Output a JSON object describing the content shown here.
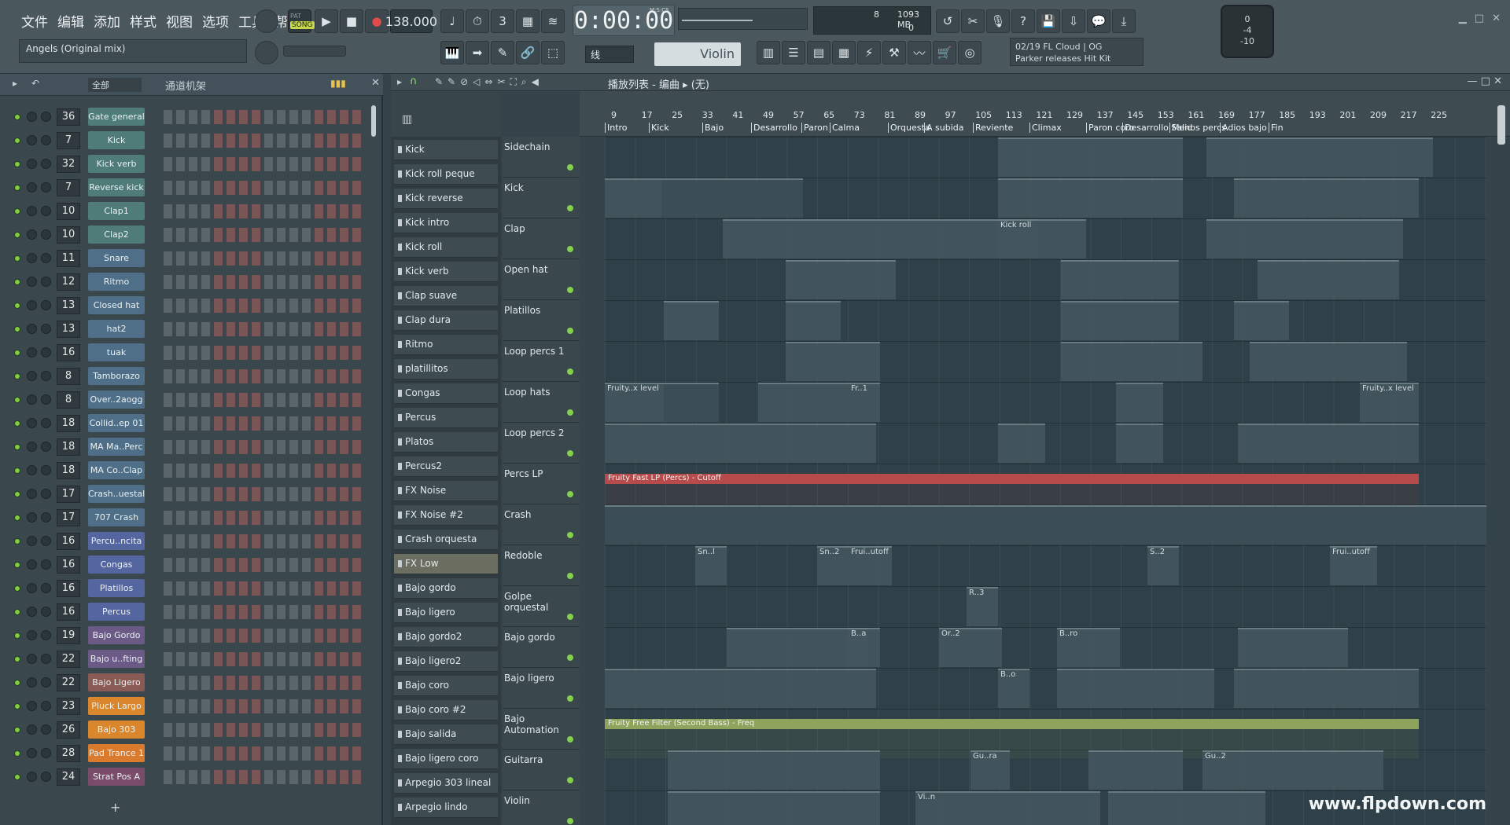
{
  "menu": [
    "文件",
    "编辑",
    "添加",
    "样式",
    "视图",
    "选项",
    "工具",
    "帮助"
  ],
  "transport": {
    "mode": "SONG",
    "bpm": "138.000",
    "time": "0:00:00",
    "time_label": "M:S:CS",
    "cpu_voices": "8",
    "memory": "1093 MB",
    "cpu_second": "0"
  },
  "song_title": "Angels (Original mix)",
  "snap": "线",
  "instrument": "Violin",
  "news": {
    "date": "02/19",
    "source": "FL Cloud | OG",
    "headline": "Parker releases Hit Kit"
  },
  "master": {
    "top": "0",
    "mid": "-4",
    "bottom": "-10"
  },
  "rack": {
    "filter": "全部",
    "title": "通道机架",
    "add": "+"
  },
  "channels": [
    {
      "num": "36",
      "name": "Gate general",
      "color": "#4f7c78"
    },
    {
      "num": "7",
      "name": "Kick",
      "color": "#4f7c78"
    },
    {
      "num": "32",
      "name": "Kick verb",
      "color": "#4f7c78"
    },
    {
      "num": "7",
      "name": "Reverse kick",
      "color": "#4f7c78"
    },
    {
      "num": "10",
      "name": "Clap1",
      "color": "#4f7c78"
    },
    {
      "num": "10",
      "name": "Clap2",
      "color": "#4f7c78"
    },
    {
      "num": "11",
      "name": "Snare",
      "color": "#4f6f88"
    },
    {
      "num": "12",
      "name": "Ritmo",
      "color": "#4f6f88"
    },
    {
      "num": "13",
      "name": "Closed hat",
      "color": "#4f6f88"
    },
    {
      "num": "13",
      "name": "hat2",
      "color": "#4f6f88"
    },
    {
      "num": "16",
      "name": "tuak",
      "color": "#4f6f88"
    },
    {
      "num": "8",
      "name": "Tamborazo",
      "color": "#4f6f88"
    },
    {
      "num": "8",
      "name": "Over..2aogg",
      "color": "#4f6f88"
    },
    {
      "num": "18",
      "name": "Collid..ep 01",
      "color": "#4f6f88"
    },
    {
      "num": "18",
      "name": "MA Ma..Perc",
      "color": "#4f6f88"
    },
    {
      "num": "18",
      "name": "MA Co..Clap",
      "color": "#4f6f88"
    },
    {
      "num": "17",
      "name": "Crash..uestal",
      "color": "#4f6f88"
    },
    {
      "num": "17",
      "name": "707 Crash",
      "color": "#4f6f88"
    },
    {
      "num": "16",
      "name": "Percu..ncita",
      "color": "#5565a0"
    },
    {
      "num": "16",
      "name": "Congas",
      "color": "#5565a0"
    },
    {
      "num": "16",
      "name": "Platillos",
      "color": "#5565a0"
    },
    {
      "num": "16",
      "name": "Percus",
      "color": "#5565a0"
    },
    {
      "num": "19",
      "name": "Bajo Gordo",
      "color": "#6b5a86"
    },
    {
      "num": "22",
      "name": "Bajo u..fting",
      "color": "#6b5a86"
    },
    {
      "num": "22",
      "name": "Bajo Ligero",
      "color": "#8a5a54"
    },
    {
      "num": "23",
      "name": "Pluck Largo",
      "color": "#d9862c"
    },
    {
      "num": "26",
      "name": "Bajo 303",
      "color": "#d9862c"
    },
    {
      "num": "28",
      "name": "Pad Trance 1",
      "color": "#d97a2c"
    },
    {
      "num": "24",
      "name": "Strat Pos A",
      "color": "#7a4c6a"
    }
  ],
  "playlist": {
    "title": "播放列表 - 编曲",
    "subtitle": "(无)",
    "add": "+"
  },
  "patterns": [
    "Kick",
    "Kick roll peque",
    "Kick reverse",
    "Kick intro",
    "Kick roll",
    "Kick verb",
    "Clap suave",
    "Clap dura",
    "Ritmo",
    "platillitos",
    "Congas",
    "Percus",
    "Platos",
    "Percus2",
    "FX Noise",
    "FX Noise #2",
    "Crash orquesta",
    "FX Low",
    "Bajo gordo",
    "Bajo ligero",
    "Bajo gordo2",
    "Bajo ligero2",
    "Bajo coro",
    "Bajo coro #2",
    "Bajo salida",
    "Bajo ligero coro",
    "Arpegio 303 lineal",
    "Arpegio lindo"
  ],
  "tracks": [
    "Sidechain",
    "Kick",
    "Clap",
    "Open hat",
    "Platillos",
    "Loop percs 1",
    "Loop hats",
    "Loop percs 2",
    "Percs LP",
    "Crash",
    "Redoble",
    "Golpe orquestal",
    "Bajo gordo",
    "Bajo ligero",
    "Bajo Automation",
    "Guitarra",
    "Violin"
  ],
  "bars": [
    "9",
    "17",
    "25",
    "33",
    "41",
    "49",
    "57",
    "65",
    "73",
    "81",
    "89",
    "97",
    "105",
    "113",
    "121",
    "129",
    "137",
    "145",
    "153",
    "161",
    "169",
    "177",
    "185",
    "193",
    "201",
    "209",
    "217",
    "225"
  ],
  "markers": [
    {
      "label": "Intro"
    },
    {
      "label": "Kick"
    },
    {
      "label": "Bajo"
    },
    {
      "label": "Desarrollo"
    },
    {
      "label": "Paron"
    },
    {
      "label": "Calma"
    },
    {
      "label": "Orquesta"
    },
    {
      "label": "A subida"
    },
    {
      "label": "Reviente"
    },
    {
      "label": "Climax"
    },
    {
      "label": "Paron coro"
    },
    {
      "label": "Desarrollo Salid"
    },
    {
      "label": "Menos percs"
    },
    {
      "label": "Adios bajo"
    },
    {
      "label": "Fin"
    }
  ],
  "clip_labels": {
    "kick_roll": "Kick roll",
    "loop_hats_1": "Fruity..x level",
    "loop_hats_2": "Fr..1",
    "loop_hats_3": "Fruity..x level",
    "percs_lp": "Fruity Fast LP (Percs) - Cutoff",
    "redoble_1": "Sn..l",
    "redoble_2": "Sn..2",
    "redoble_3": "Frui..utoff",
    "redoble_4": "S..2",
    "redoble_5": "Frui..utoff",
    "golpe": "R..3",
    "bajo_gordo_1": "B..a",
    "bajo_gordo_2": "Or..2",
    "bajo_gordo_3": "B..ro",
    "bajo_ligero_1": "B..o",
    "bajo_automation": "Fruity Free Filter (Second Bass) - Freq",
    "guitarra_1": "Gu..ra",
    "guitarra_2": "Gu..2",
    "violin_1": "Vi..n"
  },
  "watermark": "www.flpdown.com"
}
